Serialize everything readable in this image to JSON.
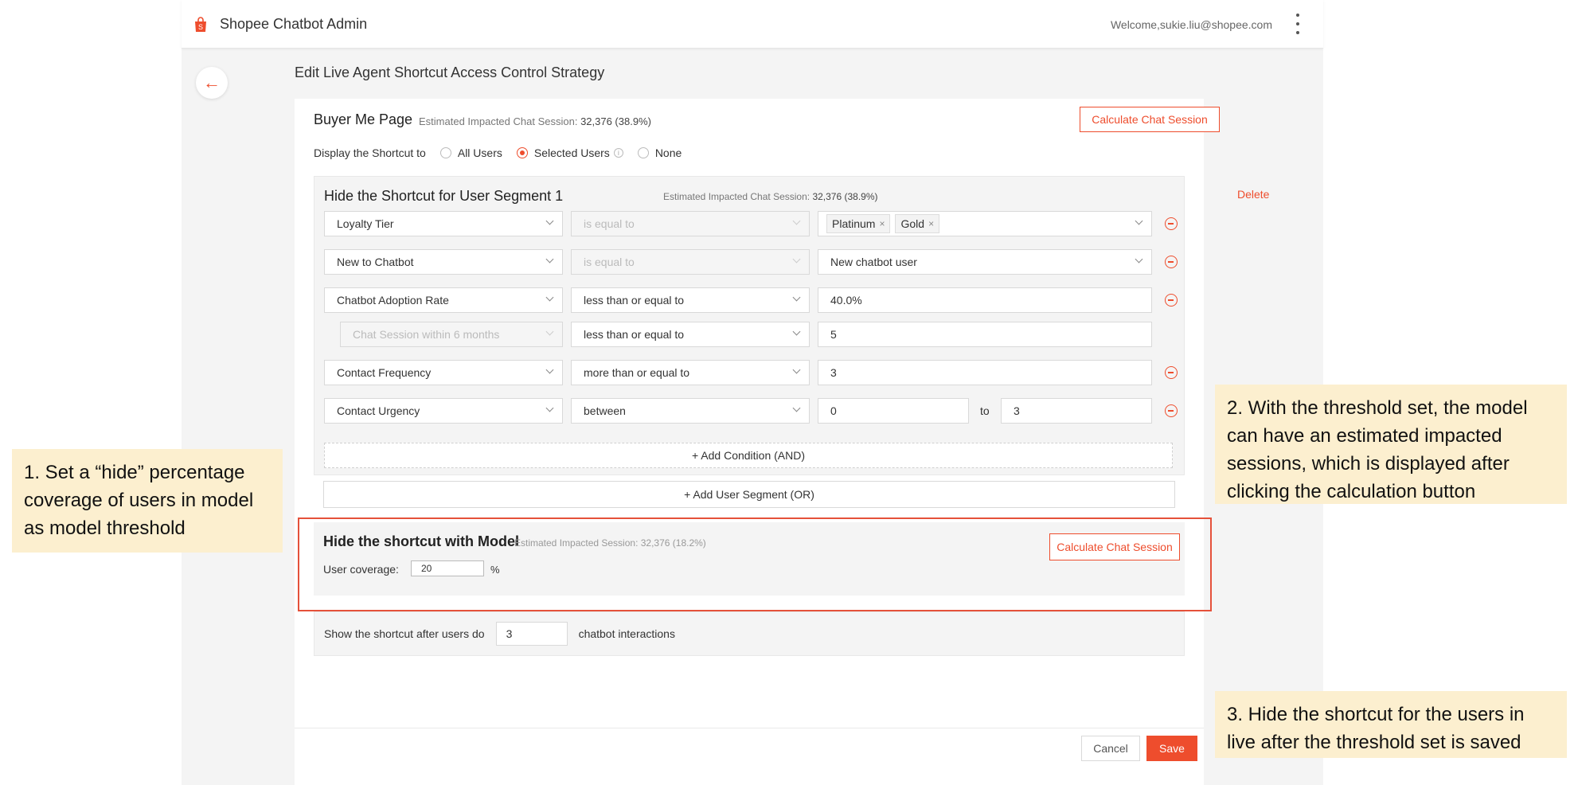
{
  "app": {
    "title": "Shopee Chatbot Admin",
    "welcome": "Welcome,sukie.liu@shopee.com",
    "accent": "#ee4d2d"
  },
  "page": {
    "title": "Edit Live Agent Shortcut Access Control Strategy"
  },
  "buyer": {
    "title": "Buyer Me Page",
    "est_label": "Estimated Impacted Chat Session:",
    "est_value": "32,376 (38.9%)",
    "calc_button": "Calculate Chat Session",
    "display_label": "Display the Shortcut to",
    "options": [
      "All Users",
      "Selected Users",
      "None"
    ],
    "selected_option": "Selected Users"
  },
  "segment": {
    "title": "Hide the Shortcut for User Segment 1",
    "est_label": "Estimated Impacted Chat Session:",
    "est_value": "32,376 (38.9%)",
    "delete": "Delete",
    "rows": [
      {
        "field": "Loyalty Tier",
        "operator": "is equal to",
        "tags": [
          "Platinum",
          "Gold"
        ]
      },
      {
        "field": "New to Chatbot",
        "operator": "is equal to",
        "value": "New chatbot user"
      },
      {
        "field": "Chatbot Adoption Rate",
        "operator": "less than or equal to",
        "value": "40.0%"
      },
      {
        "field": "Chat Session within 6 months",
        "operator": "less than or equal to",
        "value": "5"
      },
      {
        "field": "Contact Frequency",
        "operator": "more than or equal to",
        "value": "3"
      },
      {
        "field": "Contact Urgency",
        "operator": "between",
        "value_from": "0",
        "to_label": "to",
        "value_to": "3"
      }
    ],
    "add_condition": "+ Add Condition (AND)",
    "add_segment": "+ Add User Segment (OR)"
  },
  "model": {
    "title": "Hide the shortcut with Model",
    "est": "Estimated Impacted Session: 32,376 (18.2%)",
    "calc_button": "Calculate Chat Session",
    "coverage_label": "User coverage:",
    "coverage_value": "20",
    "coverage_unit": "%"
  },
  "show": {
    "prefix": "Show the shortcut after users do",
    "value": "3",
    "suffix": "chatbot interactions"
  },
  "footer": {
    "cancel": "Cancel",
    "save": "Save"
  },
  "notes": {
    "note1": "1. Set a “hide” percentage coverage of users in model as model threshold",
    "note2": "2. With the threshold set, the model can have an estimated impacted sessions, which is displayed after clicking the calculation button",
    "note3": "3. Hide the shortcut for the users in live after the threshold set is saved"
  }
}
